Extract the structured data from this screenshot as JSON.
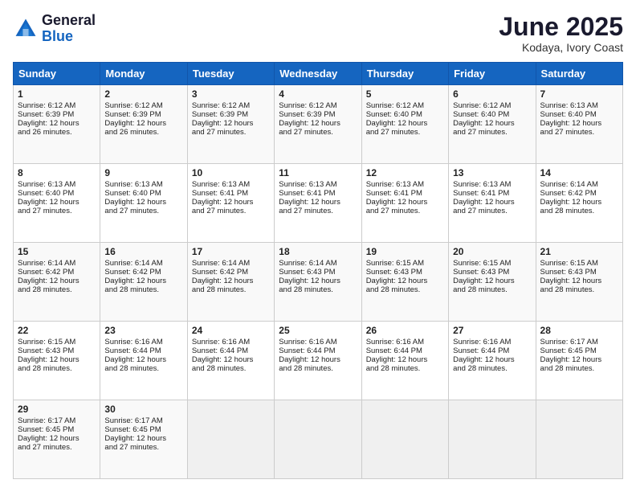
{
  "logo": {
    "line1": "General",
    "line2": "Blue"
  },
  "title": "June 2025",
  "location": "Kodaya, Ivory Coast",
  "days_header": [
    "Sunday",
    "Monday",
    "Tuesday",
    "Wednesday",
    "Thursday",
    "Friday",
    "Saturday"
  ],
  "weeks": [
    [
      {
        "day": "1",
        "info": "Sunrise: 6:12 AM\nSunset: 6:39 PM\nDaylight: 12 hours\nand 26 minutes."
      },
      {
        "day": "2",
        "info": "Sunrise: 6:12 AM\nSunset: 6:39 PM\nDaylight: 12 hours\nand 26 minutes."
      },
      {
        "day": "3",
        "info": "Sunrise: 6:12 AM\nSunset: 6:39 PM\nDaylight: 12 hours\nand 27 minutes."
      },
      {
        "day": "4",
        "info": "Sunrise: 6:12 AM\nSunset: 6:39 PM\nDaylight: 12 hours\nand 27 minutes."
      },
      {
        "day": "5",
        "info": "Sunrise: 6:12 AM\nSunset: 6:40 PM\nDaylight: 12 hours\nand 27 minutes."
      },
      {
        "day": "6",
        "info": "Sunrise: 6:12 AM\nSunset: 6:40 PM\nDaylight: 12 hours\nand 27 minutes."
      },
      {
        "day": "7",
        "info": "Sunrise: 6:13 AM\nSunset: 6:40 PM\nDaylight: 12 hours\nand 27 minutes."
      }
    ],
    [
      {
        "day": "8",
        "info": "Sunrise: 6:13 AM\nSunset: 6:40 PM\nDaylight: 12 hours\nand 27 minutes."
      },
      {
        "day": "9",
        "info": "Sunrise: 6:13 AM\nSunset: 6:40 PM\nDaylight: 12 hours\nand 27 minutes."
      },
      {
        "day": "10",
        "info": "Sunrise: 6:13 AM\nSunset: 6:41 PM\nDaylight: 12 hours\nand 27 minutes."
      },
      {
        "day": "11",
        "info": "Sunrise: 6:13 AM\nSunset: 6:41 PM\nDaylight: 12 hours\nand 27 minutes."
      },
      {
        "day": "12",
        "info": "Sunrise: 6:13 AM\nSunset: 6:41 PM\nDaylight: 12 hours\nand 27 minutes."
      },
      {
        "day": "13",
        "info": "Sunrise: 6:13 AM\nSunset: 6:41 PM\nDaylight: 12 hours\nand 27 minutes."
      },
      {
        "day": "14",
        "info": "Sunrise: 6:14 AM\nSunset: 6:42 PM\nDaylight: 12 hours\nand 28 minutes."
      }
    ],
    [
      {
        "day": "15",
        "info": "Sunrise: 6:14 AM\nSunset: 6:42 PM\nDaylight: 12 hours\nand 28 minutes."
      },
      {
        "day": "16",
        "info": "Sunrise: 6:14 AM\nSunset: 6:42 PM\nDaylight: 12 hours\nand 28 minutes."
      },
      {
        "day": "17",
        "info": "Sunrise: 6:14 AM\nSunset: 6:42 PM\nDaylight: 12 hours\nand 28 minutes."
      },
      {
        "day": "18",
        "info": "Sunrise: 6:14 AM\nSunset: 6:43 PM\nDaylight: 12 hours\nand 28 minutes."
      },
      {
        "day": "19",
        "info": "Sunrise: 6:15 AM\nSunset: 6:43 PM\nDaylight: 12 hours\nand 28 minutes."
      },
      {
        "day": "20",
        "info": "Sunrise: 6:15 AM\nSunset: 6:43 PM\nDaylight: 12 hours\nand 28 minutes."
      },
      {
        "day": "21",
        "info": "Sunrise: 6:15 AM\nSunset: 6:43 PM\nDaylight: 12 hours\nand 28 minutes."
      }
    ],
    [
      {
        "day": "22",
        "info": "Sunrise: 6:15 AM\nSunset: 6:43 PM\nDaylight: 12 hours\nand 28 minutes."
      },
      {
        "day": "23",
        "info": "Sunrise: 6:16 AM\nSunset: 6:44 PM\nDaylight: 12 hours\nand 28 minutes."
      },
      {
        "day": "24",
        "info": "Sunrise: 6:16 AM\nSunset: 6:44 PM\nDaylight: 12 hours\nand 28 minutes."
      },
      {
        "day": "25",
        "info": "Sunrise: 6:16 AM\nSunset: 6:44 PM\nDaylight: 12 hours\nand 28 minutes."
      },
      {
        "day": "26",
        "info": "Sunrise: 6:16 AM\nSunset: 6:44 PM\nDaylight: 12 hours\nand 28 minutes."
      },
      {
        "day": "27",
        "info": "Sunrise: 6:16 AM\nSunset: 6:44 PM\nDaylight: 12 hours\nand 28 minutes."
      },
      {
        "day": "28",
        "info": "Sunrise: 6:17 AM\nSunset: 6:45 PM\nDaylight: 12 hours\nand 28 minutes."
      }
    ],
    [
      {
        "day": "29",
        "info": "Sunrise: 6:17 AM\nSunset: 6:45 PM\nDaylight: 12 hours\nand 27 minutes."
      },
      {
        "day": "30",
        "info": "Sunrise: 6:17 AM\nSunset: 6:45 PM\nDaylight: 12 hours\nand 27 minutes."
      },
      {
        "day": "",
        "info": ""
      },
      {
        "day": "",
        "info": ""
      },
      {
        "day": "",
        "info": ""
      },
      {
        "day": "",
        "info": ""
      },
      {
        "day": "",
        "info": ""
      }
    ]
  ]
}
